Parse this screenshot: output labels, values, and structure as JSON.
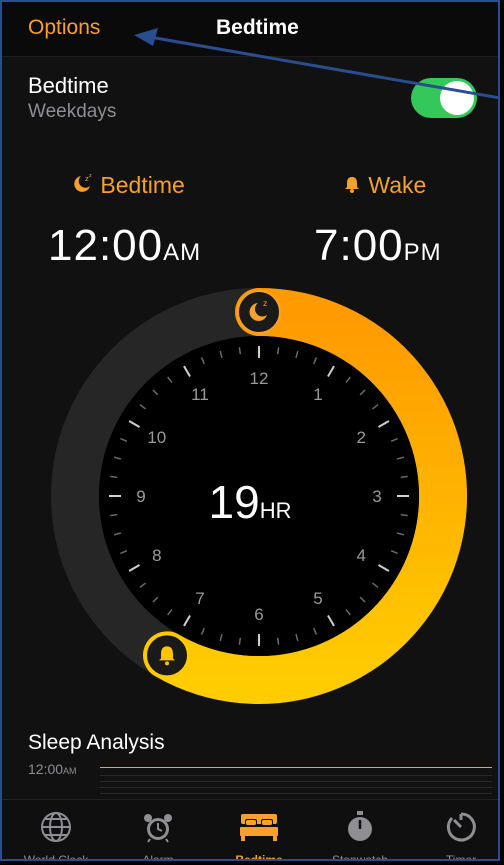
{
  "header": {
    "options_label": "Options",
    "title": "Bedtime"
  },
  "bedtime_row": {
    "title": "Bedtime",
    "subtitle": "Weekdays",
    "toggle_on": true
  },
  "schedule": {
    "bedtime_label": "Bedtime",
    "bedtime_time": "12:00",
    "bedtime_ampm": "AM",
    "wake_label": "Wake",
    "wake_time": "7:00",
    "wake_ampm": "PM"
  },
  "clock": {
    "duration_value": "19",
    "duration_unit": "HR",
    "hour_numbers": [
      "12",
      "1",
      "2",
      "3",
      "4",
      "5",
      "6",
      "7",
      "8",
      "9",
      "10",
      "11"
    ],
    "bedtime_hour": 0,
    "wake_hour": 19
  },
  "sleep_analysis": {
    "title": "Sleep Analysis",
    "time": "12:00",
    "ampm": "AM"
  },
  "tabs": [
    {
      "label": "World Clock",
      "icon": "globe-icon"
    },
    {
      "label": "Alarm",
      "icon": "alarm-clock-icon"
    },
    {
      "label": "Bedtime",
      "icon": "bed-icon",
      "active": true
    },
    {
      "label": "Stopwatch",
      "icon": "stopwatch-icon"
    },
    {
      "label": "Timer",
      "icon": "timer-icon"
    }
  ],
  "colors": {
    "accent": "#f7a12c",
    "toggle_on": "#34c759",
    "background": "#111111",
    "annotation_arrow": "#2a4d8f"
  }
}
